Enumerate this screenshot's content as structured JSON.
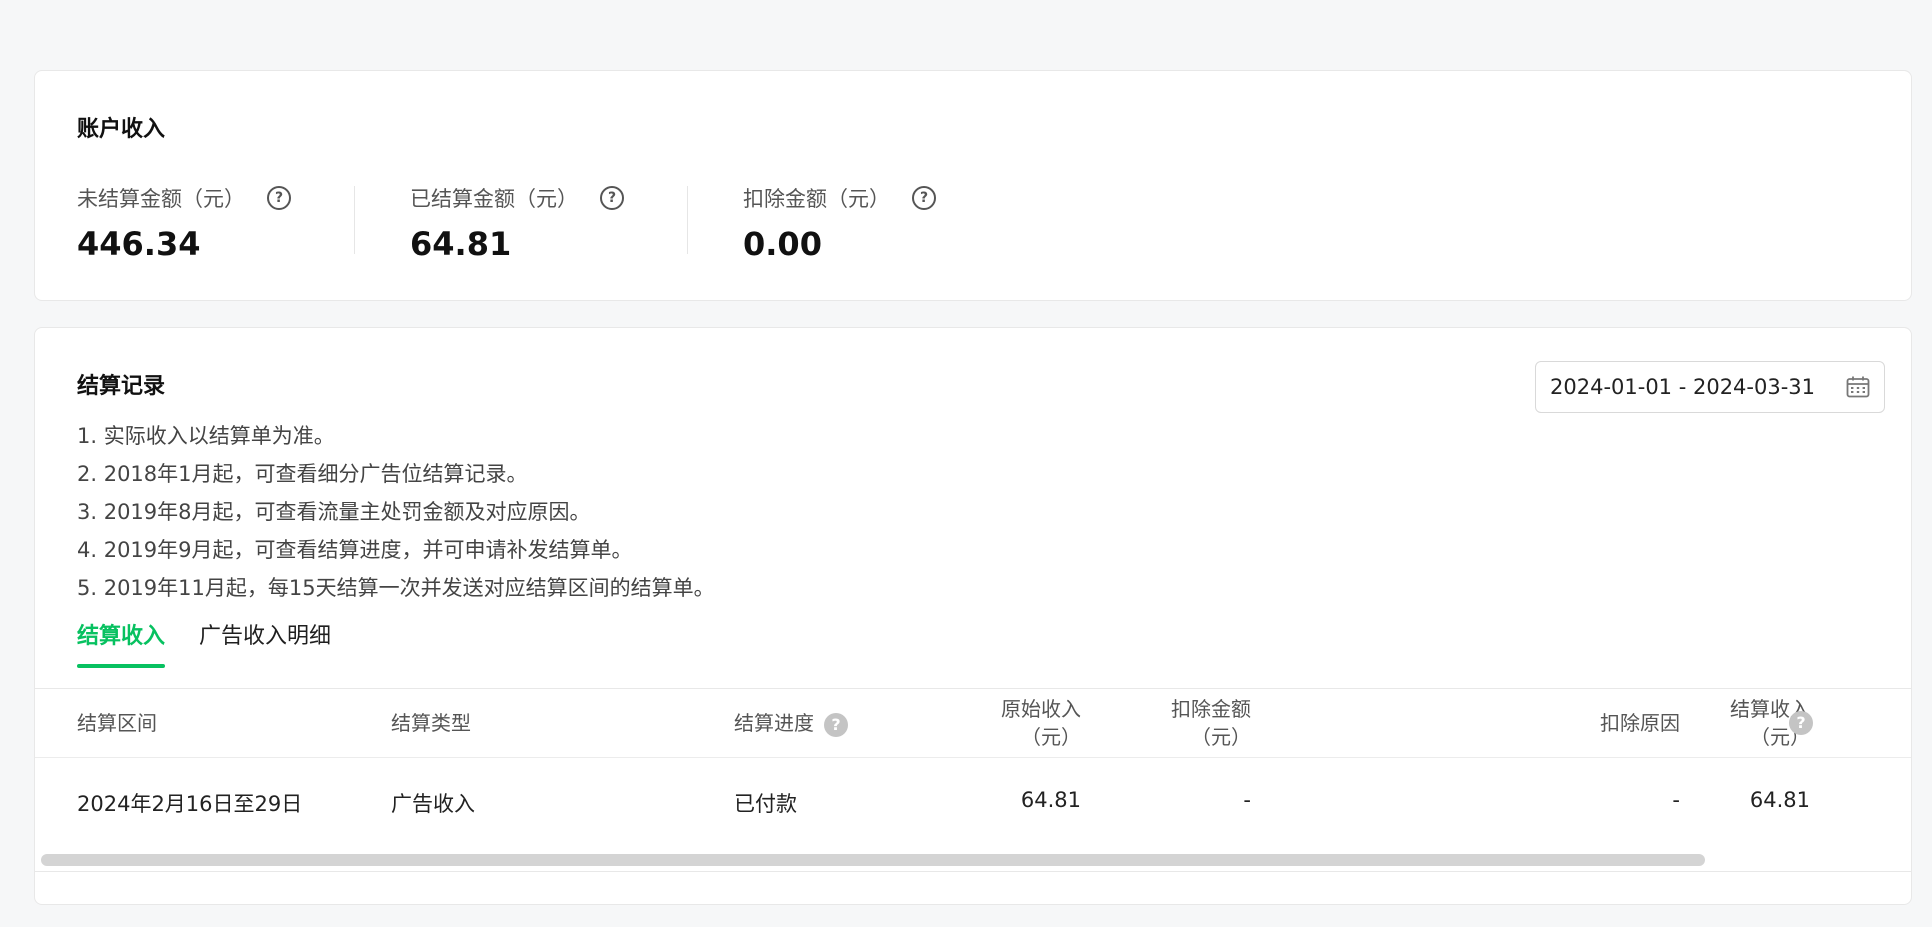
{
  "account_income": {
    "title": "账户收入",
    "metrics": [
      {
        "label": "未结算金额（元）",
        "value": "446.34"
      },
      {
        "label": "已结算金额（元）",
        "value": "64.81"
      },
      {
        "label": "扣除金额（元）",
        "value": "0.00"
      }
    ]
  },
  "records": {
    "title": "结算记录",
    "date_range": "2024-01-01 - 2024-03-31",
    "notes": [
      "1. 实际收入以结算单为准。",
      "2. 2018年1月起，可查看细分广告位结算记录。",
      "3. 2019年8月起，可查看流量主处罚金额及对应原因。",
      "4. 2019年9月起，可查看结算进度，并可申请补发结算单。",
      "5. 2019年11月起，每15天结算一次并发送对应结算区间的结算单。"
    ],
    "tabs": [
      {
        "label": "结算收入",
        "active": true
      },
      {
        "label": "广告收入明细",
        "active": false
      }
    ],
    "columns": {
      "period": "结算区间",
      "type": "结算类型",
      "progress": "结算进度",
      "original_line1": "原始收入",
      "original_line2": "（元）",
      "deduct_line1": "扣除金额",
      "deduct_line2": "（元）",
      "reason": "扣除原因",
      "income_line1": "结算收入",
      "income_line2": "（元）"
    },
    "rows": [
      {
        "period": "2024年2月16日至29日",
        "type": "广告收入",
        "progress": "已付款",
        "original": "64.81",
        "deduct": "-",
        "reason": "-",
        "income": "64.81"
      }
    ]
  },
  "colors": {
    "accent": "#07c160",
    "background": "#f6f7f8"
  },
  "icons": {
    "help": "question-circle-icon",
    "calendar": "calendar-icon"
  }
}
